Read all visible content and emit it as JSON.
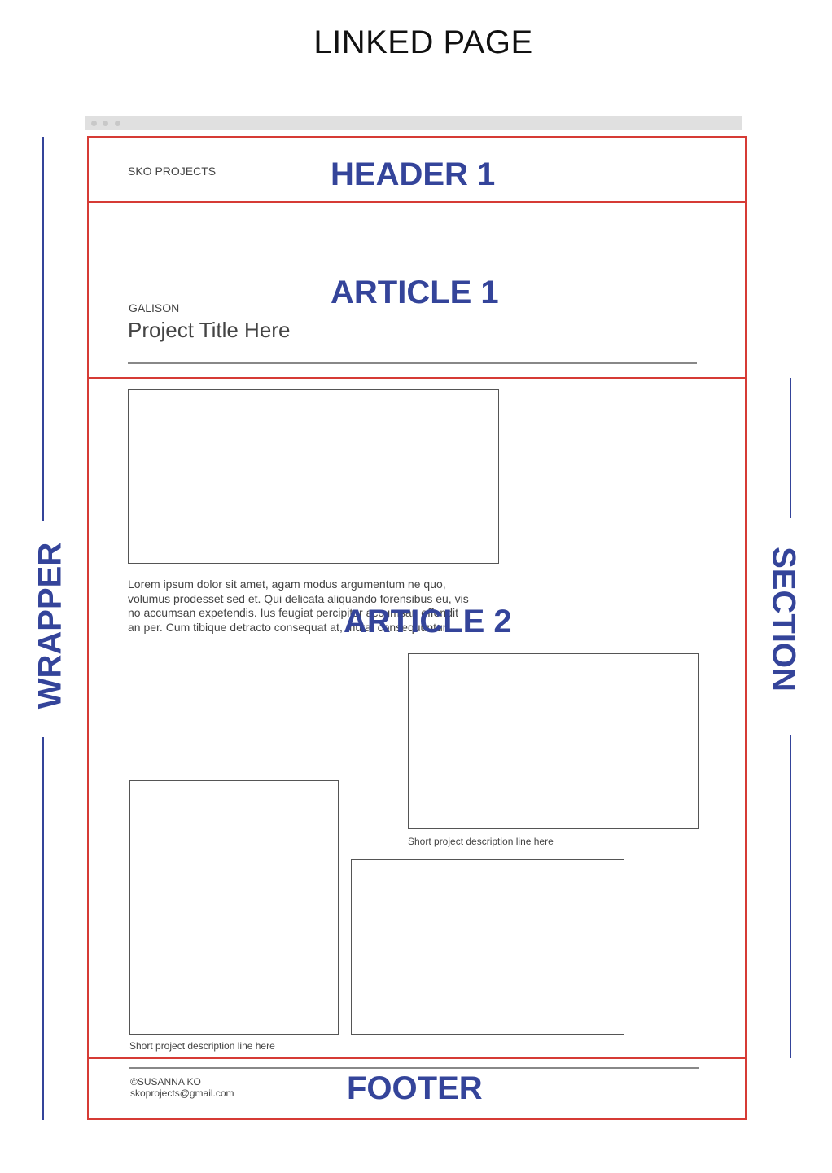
{
  "title": "LINKED PAGE",
  "regions": {
    "header": "HEADER 1",
    "article1": "ARTICLE 1",
    "article2": "ARTICLE 2",
    "footer": "FOOTER"
  },
  "side_labels": {
    "wrapper": "WRAPPER",
    "section": "SECTION"
  },
  "site": {
    "brand": "SKO PROJECTS",
    "category": "GALISON",
    "project_title": "Project Title Here",
    "body_text_lines": [
      "Lorem ipsum dolor sit amet, agam modus argumentum ne quo,",
      "volumus prodesset sed et. Qui delicata aliquando forensibus eu, vis",
      "no accumsan expetendis. Ius feugiat percipitur accumsan offendit",
      "an per. Cum tibique detracto consequat at, mutat consequuntur"
    ],
    "caption_1": "Short project description line here",
    "caption_2": "Short project description line here",
    "footer_copyright": "©SUSANNA KO",
    "footer_email": "skoprojects@gmail.com"
  },
  "colors": {
    "region_border": "#d63b35",
    "label": "#34449a"
  }
}
